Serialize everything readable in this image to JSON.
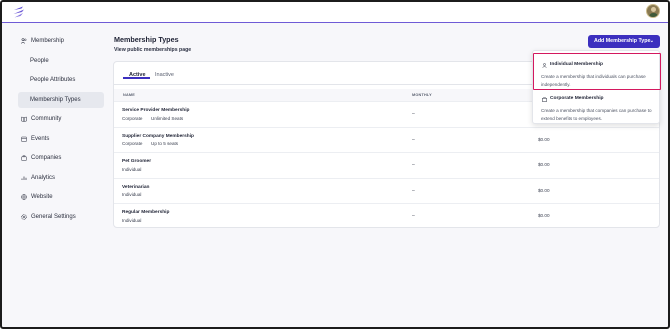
{
  "sidebar": {
    "items": [
      {
        "label": "Membership",
        "icon": "people-icon"
      },
      {
        "label": "People"
      },
      {
        "label": "People Attributes"
      },
      {
        "label": "Membership Types"
      },
      {
        "label": "Community",
        "icon": "book-icon"
      },
      {
        "label": "Events",
        "icon": "calendar-icon"
      },
      {
        "label": "Companies",
        "icon": "briefcase-icon"
      },
      {
        "label": "Analytics",
        "icon": "chart-icon"
      },
      {
        "label": "Website",
        "icon": "globe-icon"
      },
      {
        "label": "General Settings",
        "icon": "gear-icon"
      }
    ]
  },
  "main": {
    "title": "Membership Types",
    "link": "View public memberships page",
    "add_button": "Add Membership Type",
    "tabs": [
      "Active",
      "Inactive"
    ],
    "columns": [
      "NAME",
      "MONTHLY"
    ],
    "rows": [
      {
        "name": "Service Provider Membership",
        "type": "Corporate",
        "limit": "Unlimited Seats",
        "monthly": "–",
        "price": ""
      },
      {
        "name": "Supplier Company Membership",
        "type": "Corporate",
        "limit": "Up to 5 seats",
        "monthly": "–",
        "price": "$0.00"
      },
      {
        "name": "Pet Groomer",
        "type": "Individual",
        "limit": "",
        "monthly": "–",
        "price": "$0.00"
      },
      {
        "name": "Veterinarian",
        "type": "Individual",
        "limit": "",
        "monthly": "–",
        "price": "$0.00"
      },
      {
        "name": "Regular Membership",
        "type": "Individual",
        "limit": "",
        "monthly": "–",
        "price": "$0.00"
      }
    ]
  },
  "dropdown": {
    "options": [
      {
        "title": "Individual Membership",
        "desc": "Create a membership that individuals can purchase independently.",
        "icon": "person-icon"
      },
      {
        "title": "Corporate Membership",
        "desc": "Create a membership that companies can purchase to extend benefits to employees.",
        "icon": "building-icon"
      }
    ]
  },
  "colors": {
    "accent": "#3c2fbf",
    "highlight": "#d4185f"
  }
}
